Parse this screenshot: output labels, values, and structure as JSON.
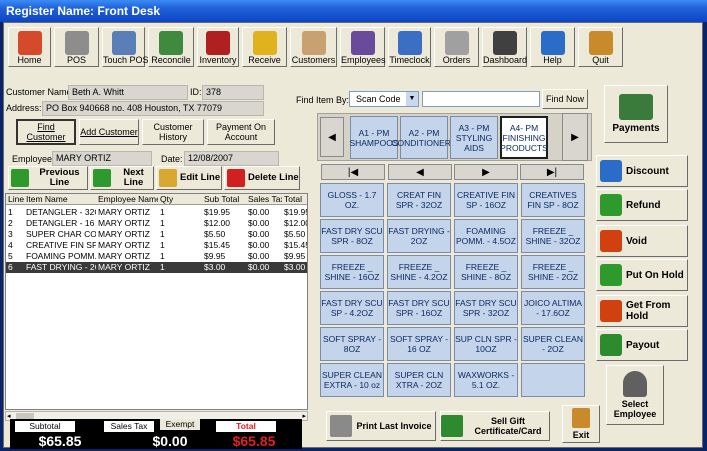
{
  "window": {
    "title": "Register Name: Front Desk"
  },
  "toolbar": [
    {
      "label": "Home",
      "icon": "house-icon",
      "color": "#d44a2a"
    },
    {
      "label": "POS",
      "icon": "cash-register-icon",
      "color": "#8d8d8d"
    },
    {
      "label": "Touch POS",
      "icon": "touch-register-icon",
      "color": "#5b7db8"
    },
    {
      "label": "Reconcile",
      "icon": "money-stack-icon",
      "color": "#3f8a3f"
    },
    {
      "label": "Inventory",
      "icon": "product-box-icon",
      "color": "#b02020"
    },
    {
      "label": "Receive",
      "icon": "forklift-icon",
      "color": "#e0b21e"
    },
    {
      "label": "Customers",
      "icon": "handshake-icon",
      "color": "#c9a070"
    },
    {
      "label": "Employees",
      "icon": "people-icon",
      "color": "#6a4a9a"
    },
    {
      "label": "Timeclock",
      "icon": "clock-icon",
      "color": "#3a6fc4"
    },
    {
      "label": "Orders",
      "icon": "clipboard-icon",
      "color": "#a0a0a0"
    },
    {
      "label": "Dashboard",
      "icon": "gauge-icon",
      "color": "#404040"
    },
    {
      "label": "Help",
      "icon": "help-icon",
      "color": "#2a6cc8"
    },
    {
      "label": "Quit",
      "icon": "door-exit-icon",
      "color": "#c88a2a"
    }
  ],
  "customer": {
    "name_label": "Customer Name:",
    "name": "Beth A. Whitt",
    "id_label": "ID:",
    "id": "378",
    "address_label": "Address:",
    "address": "PO Box 940668 no. 408 Houston, TX 77079"
  },
  "customer_buttons": [
    {
      "label": "Find Customer"
    },
    {
      "label": "Add Customer"
    },
    {
      "label": "Customer History"
    },
    {
      "label": "Payment On Account"
    }
  ],
  "employee": {
    "label": "Employee:",
    "name": "MARY ORTIZ",
    "date_label": "Date:",
    "date": "12/08/2007"
  },
  "line_buttons": [
    {
      "label": "Previous Line",
      "icon": "up-arrow-icon",
      "color": "#2e9a2e"
    },
    {
      "label": "Next Line",
      "icon": "down-arrow-icon",
      "color": "#2e9a2e"
    },
    {
      "label": "Edit Line",
      "icon": "folder-icon",
      "color": "#d8a830"
    },
    {
      "label": "Delete Line",
      "icon": "red-x-icon",
      "color": "#d02020"
    }
  ],
  "grid": {
    "headers": [
      "Line",
      "Item Name",
      "Employee Name",
      "Qty",
      "Sub Total",
      "Sales Tax",
      "Total"
    ],
    "rows": [
      [
        "1",
        "DETANGLER - 32O",
        "MARY ORTIZ",
        "1",
        "$19.95",
        "$0.00",
        "$19.95"
      ],
      [
        "2",
        "DETANGLER - 16 C",
        "MARY ORTIZ",
        "1",
        "$12.00",
        "$0.00",
        "$12.00"
      ],
      [
        "3",
        "SUPER CHAR CON",
        "MARY ORTIZ",
        "1",
        "$5.50",
        "$0.00",
        "$5.50"
      ],
      [
        "4",
        "CREATIVE FIN SP",
        "MARY ORTIZ",
        "1",
        "$15.45",
        "$0.00",
        "$15.45"
      ],
      [
        "5",
        "FOAMING POMM.",
        "MARY ORTIZ",
        "1",
        "$9.95",
        "$0.00",
        "$9.95"
      ],
      [
        "6",
        "FAST DRYING - 2C",
        "MARY ORTIZ",
        "1",
        "$3.00",
        "$0.00",
        "$3.00"
      ]
    ],
    "selected_row": 5
  },
  "totals": {
    "subtotal_label": "Subtotal",
    "subtotal": "$65.85",
    "tax_label": "Sales Tax",
    "exempt_label": "Exempt",
    "tax": "$0.00",
    "total_label": "Total",
    "total": "$65.85",
    "total_color": "#e02020"
  },
  "find": {
    "label": "Find Item By:",
    "mode": "Scan Code",
    "button": "Find Now"
  },
  "categories": [
    {
      "label": "A1 - PM SHAMPOOS"
    },
    {
      "label": "A2 - PM CONDITIONERS"
    },
    {
      "label": "A3 - PM STYLING AIDS"
    },
    {
      "label": "A4- PM FINISHING PRODUCTS"
    }
  ],
  "active_category": 3,
  "items": [
    "GLOSS - 1.7 OZ.",
    "CREAT FIN SPR - 32OZ",
    "CREATIVE FIN SP - 16OZ",
    "CREATIVES FIN SP - 8OZ",
    "FAST DRY SCU SPR - 8OZ",
    "FAST DRYING - 2OZ",
    "FOAMING POMM. - 4.5OZ",
    "FREEZE _ SHINE - 32OZ",
    "FREEZE _ SHINE - 16OZ",
    "FREEZE _ SHINE - 4.2OZ",
    "FREEZE _ SHINE - 8OZ",
    "FREEZE _ SHINE - 2OZ",
    "FAST DRY SCU SP - 4.2OZ",
    "FAST DRY SCU SPR - 16OZ",
    "FAST DRY SCU SPR - 32OZ",
    "JOICO ALTIMA - 17.6OZ",
    "SOFT SPRAY - 8OZ",
    "SOFT SPRAY - 16 OZ",
    "SUP CLN SPR - 10OZ",
    "SUPER CLEAN - 2OZ",
    "SUPER CLEAN EXTRA - 10 oz",
    "SUPER CLN XTRA - 2OZ",
    "WAXWORKS - 5.1 OZ.",
    ""
  ],
  "side_buttons": [
    {
      "label": "Payments",
      "icon": "payment-cards-icon",
      "color": "#3a7a3a"
    },
    {
      "label": "Discount",
      "icon": "down-arrow-icon",
      "color": "#2a6cc8"
    },
    {
      "label": "Refund",
      "icon": "refresh-arrows-icon",
      "color": "#2e9a2e"
    },
    {
      "label": "Void",
      "icon": "void-x-icon",
      "color": "#d04010"
    },
    {
      "label": "Put On Hold",
      "icon": "hold-arrow-icon",
      "color": "#2e9a2e"
    },
    {
      "label": "Get From Hold",
      "icon": "get-hold-icon",
      "color": "#d04010"
    },
    {
      "label": "Payout",
      "icon": "cash-payout-icon",
      "color": "#2e8a2e"
    },
    {
      "label": "Select Employee",
      "icon": "employee-person-icon",
      "color": "#606060"
    }
  ],
  "bottom_buttons": [
    {
      "label": "Print Last Invoice",
      "icon": "printer-icon",
      "color": "#8a8a8a"
    },
    {
      "label": "Sell Gift Certificate/Card",
      "icon": "gift-cash-icon",
      "color": "#2e8a2e"
    },
    {
      "label": "Exit",
      "icon": "exit-door-icon",
      "color": "#c88a2a"
    }
  ]
}
